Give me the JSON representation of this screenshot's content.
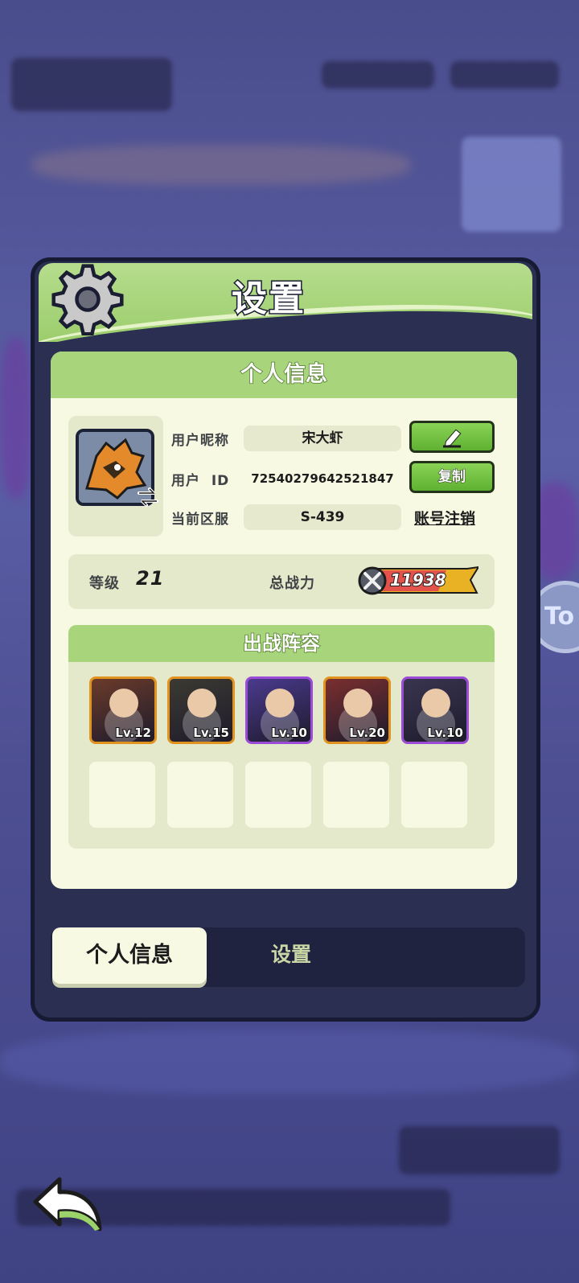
{
  "title": "设置",
  "section_title": "个人信息",
  "profile": {
    "nickname_label": "用户昵称",
    "nickname_value": "宋大虾",
    "id_label": "用户  ID",
    "id_value": "72540279642521847",
    "server_label": "当前区服",
    "server_value": "S-439",
    "copy_button": "复制",
    "logout_link": "账号注销"
  },
  "stats": {
    "level_label": "等级",
    "level_value": "21",
    "power_label": "总战力",
    "power_value": "11938"
  },
  "lineup": {
    "title": "出战阵容",
    "heroes": [
      {
        "level": "Lv.12",
        "border": "#e0931e"
      },
      {
        "level": "Lv.15",
        "border": "#e0931e"
      },
      {
        "level": "Lv.10",
        "border": "#9b4bd6"
      },
      {
        "level": "Lv.20",
        "border": "#e0931e"
      },
      {
        "level": "Lv.10",
        "border": "#9b4bd6"
      }
    ],
    "empty_slots": 5
  },
  "tabs": {
    "personal": "个人信息",
    "settings": "设置"
  },
  "side_bubble_text": "To",
  "icons": {
    "gear": "gear-icon",
    "edit": "pencil-icon",
    "swap": "swap-arrows-icon",
    "power": "crossed-swords-icon",
    "back": "back-arrow-icon"
  },
  "colors": {
    "accent_green": "#9ccd6d",
    "card_bg": "#f7f9e3",
    "panel_bg": "#2b2f52"
  }
}
